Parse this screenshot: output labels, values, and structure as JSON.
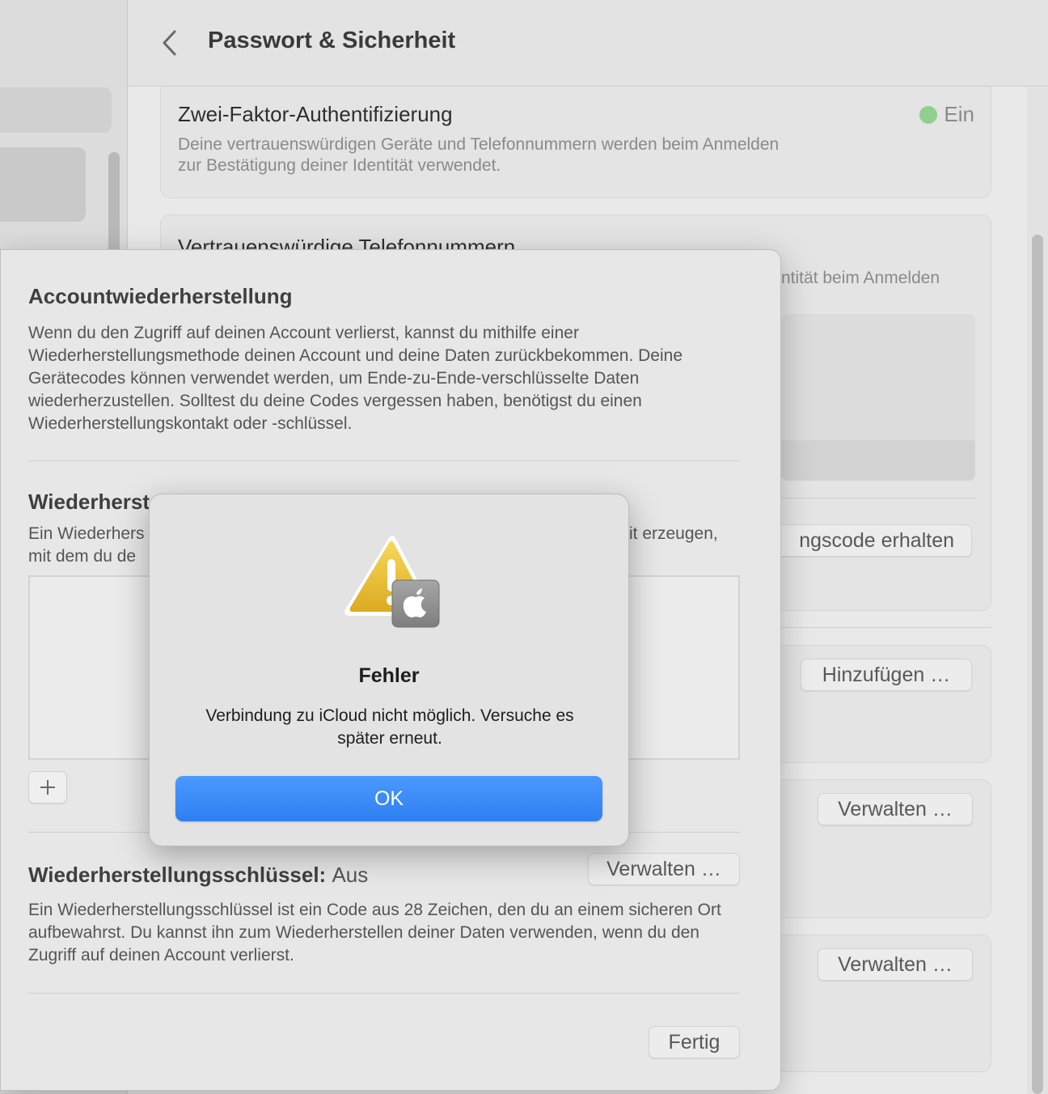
{
  "header": {
    "title": "Passwort & Sicherheit"
  },
  "two_factor": {
    "title": "Zwei-Faktor-Authentifizierung",
    "status": "Ein",
    "description": "Deine vertrauenswürdigen Geräte und Telefonnummern werden beim Anmelden zur Bestätigung deiner Identität verwendet."
  },
  "trusted_phones": {
    "title": "Vertrauenswürdige Telefonnummern",
    "description_fragment": "ntität beim Anmelden"
  },
  "background_buttons": {
    "get_code": "ngscode erhalten",
    "add": "Hinzufügen …",
    "manage_1": "Verwalten …",
    "manage_2": "Verwalten …"
  },
  "sheet": {
    "title": "Accountwiederherstellung",
    "intro": "Wenn du den Zugriff auf deinen Account verlierst, kannst du mithilfe einer Wiederherstellungsmethode deinen Account und deine Daten zurückbekommen. Deine Gerätecodes können verwendet werden, um Ende-zu-Ende-verschlüsselte Daten wiederherzustellen. Solltest du deine Codes vergessen haben, benötigst du einen Wiederherstellungskontakt oder -schlüssel.",
    "contacts_title": "Wiederherst",
    "contacts_desc_line1_left": "Ein Wiederhers",
    "contacts_desc_line1_right": "it erzeugen,",
    "contacts_desc_line2_left": "mit dem du de",
    "key_title": "Wiederherstellungsschlüssel:",
    "key_status": "Aus",
    "key_manage": "Verwalten …",
    "key_desc": "Ein Wiederherstellungsschlüssel ist ein Code aus 28 Zeichen, den du an einem sicheren Ort aufbewahrst. Du kannst ihn zum Wiederherstellen deiner Daten verwenden, wenn du den Zugriff auf deinen Account verlierst.",
    "done": "Fertig"
  },
  "alert": {
    "icon": "warning-triangle-with-apple-badge",
    "title": "Fehler",
    "message": "Verbindung zu iCloud nicht möglich. Versuche es später erneut.",
    "ok": "OK"
  },
  "colors": {
    "accent": "#3385f5",
    "status_on": "#8fd08f",
    "warning": "#f0c22e"
  }
}
